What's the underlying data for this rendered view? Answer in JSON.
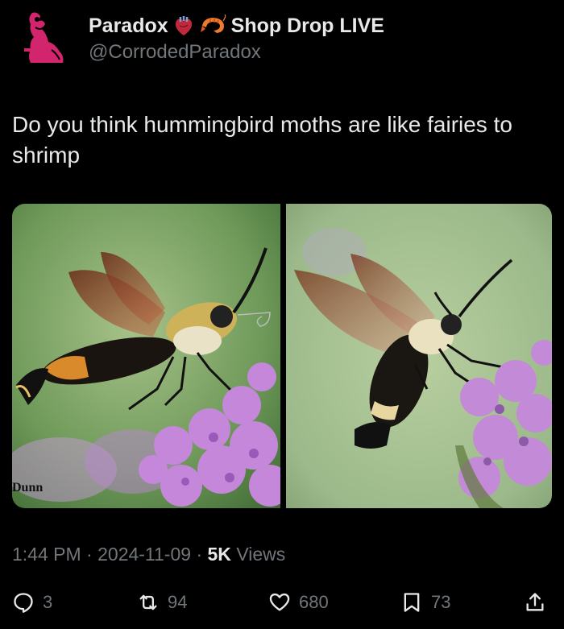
{
  "author": {
    "display_name": "Paradox",
    "name_suffix": "Shop Drop LIVE",
    "name_emojis": [
      "anatomical-heart-icon",
      "shrimp-icon"
    ],
    "handle": "@CorrodedParadox"
  },
  "tweet": {
    "text": "Do you think hummingbird moths are like fairies to shrimp"
  },
  "media": {
    "photo_credit": "Dunn"
  },
  "meta": {
    "time": "1:44 PM",
    "separator": "·",
    "date": "2024-11-09",
    "views_count": "5K",
    "views_label": "Views"
  },
  "actions": {
    "replies": "3",
    "reposts": "94",
    "likes": "680",
    "bookmarks": "73"
  },
  "colors": {
    "background": "#000000",
    "text_primary": "#e7e9ea",
    "text_secondary": "#71767b",
    "avatar_accent": "#d2256e"
  }
}
